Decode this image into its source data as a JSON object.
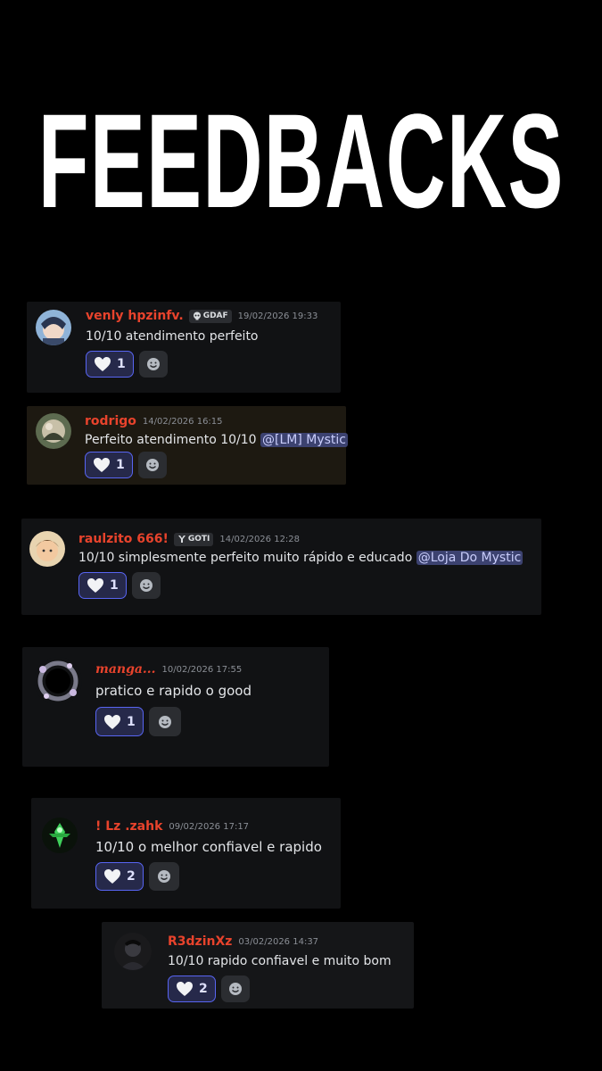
{
  "page_title": "FEEDBACKS",
  "messages": [
    {
      "username": "venly hpzinfv.",
      "tag": "GDAF",
      "timestamp": "19/02/2026 19:33",
      "text": "10/10 atendimento perfeito",
      "mention": "",
      "reaction_count": "1"
    },
    {
      "username": "rodrigo",
      "tag": "",
      "timestamp": "14/02/2026 16:15",
      "text": "Perfeito atendimento 10/10",
      "mention": "@[LM] Mystic",
      "reaction_count": "1"
    },
    {
      "username": "raulzito 666!",
      "tag": "GOTI",
      "timestamp": "14/02/2026 12:28",
      "text": "10/10 simplesmente perfeito muito rápido e educado",
      "mention": "@Loja Do Mystic",
      "reaction_count": "1"
    },
    {
      "username": "manga...",
      "tag": "",
      "timestamp": "10/02/2026 17:55",
      "text": "pratico e rapido o good",
      "mention": "",
      "reaction_count": "1"
    },
    {
      "username": "! Lz .zahk",
      "tag": "",
      "timestamp": "09/02/2026 17:17",
      "text": "10/10 o melhor confiavel e rapido",
      "mention": "",
      "reaction_count": "2"
    },
    {
      "username": "R3dzinXz",
      "tag": "",
      "timestamp": "03/02/2026 14:37",
      "text": "10/10 rapido confiavel e muito bom",
      "mention": "",
      "reaction_count": "2"
    }
  ],
  "icons": {
    "reaction": "heart-icon",
    "add_reaction": "smile-icon",
    "tag_1": "skull-icon",
    "tag_3": "goat-icon"
  },
  "colors": {
    "background": "#000000",
    "card": "#111214",
    "username": "#e8432c",
    "reaction_border": "#5865f2",
    "mention_bg": "#3c4270"
  }
}
